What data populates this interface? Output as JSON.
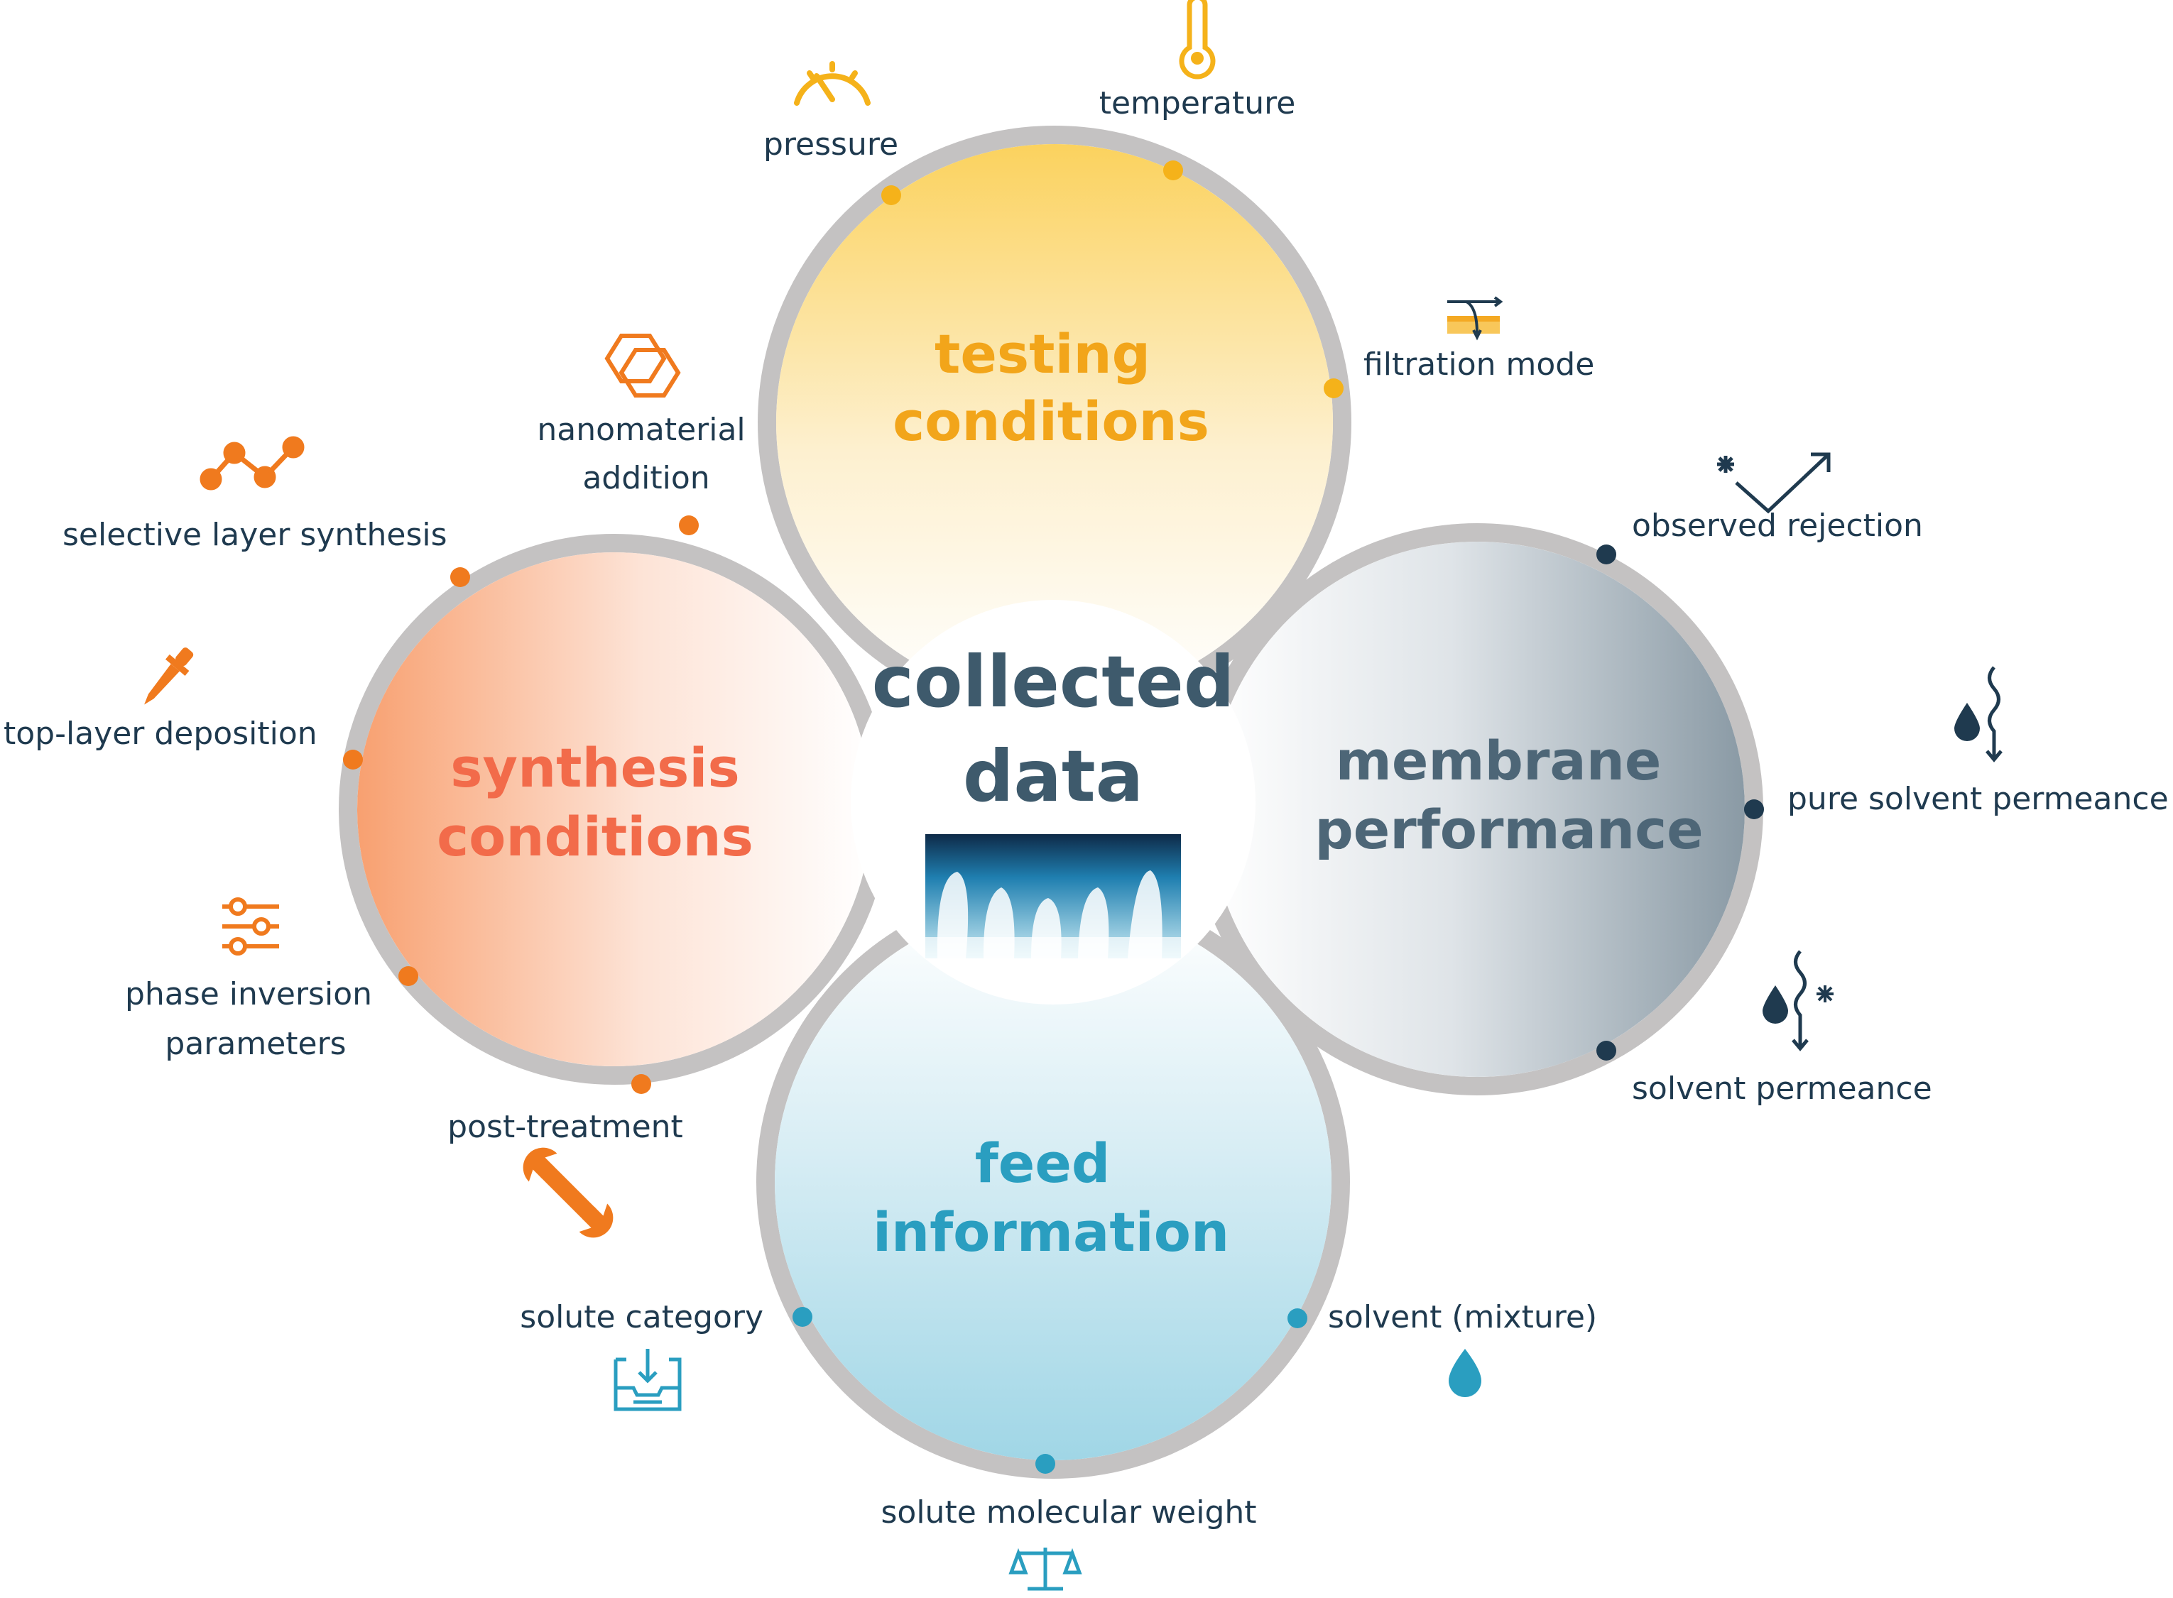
{
  "center": {
    "line1": "collected",
    "line2": "data"
  },
  "petals": {
    "testing": {
      "line1": "testing",
      "line2": "conditions"
    },
    "synthesis": {
      "line1": "synthesis",
      "line2": "conditions"
    },
    "membrane": {
      "line1": "membrane",
      "line2": "performance"
    },
    "feed": {
      "line1": "feed",
      "line2": "information"
    }
  },
  "labels": {
    "pressure": "pressure",
    "temperature": "temperature",
    "filtration_mode": "filtration mode",
    "nanomaterial_1": "nanomaterial",
    "nanomaterial_2": "addition",
    "selective_layer": "selective layer synthesis",
    "top_layer": "top-layer deposition",
    "phase_inversion_1": "phase inversion",
    "phase_inversion_2": "parameters",
    "post_treatment": "post-treatment",
    "observed_rejection": "observed rejection",
    "pure_solvent": "pure solvent permeance",
    "solvent_permeance": "solvent permeance",
    "solute_category": "solute category",
    "solvent_mixture": "solvent (mixture)",
    "solute_mw": "solute molecular weight"
  },
  "icons": [
    "gauge-icon",
    "thermometer-icon",
    "filtration-mode-icon",
    "hexagon-icon",
    "line-graph-icon",
    "dropper-icon",
    "sliders-icon",
    "wrench-icon",
    "rejection-icon",
    "droplet-wave-icon",
    "droplet-wave-star-icon",
    "inbox-icon",
    "droplet-icon",
    "balance-icon"
  ],
  "colors": {
    "testing": "#f7b500",
    "synthesis": "#f26b4a",
    "membrane": "#4d6677",
    "feed": "#2a9ec0",
    "orange_icon": "#f07a1e",
    "navy": "#1f3a4f",
    "ring": "#c4c2c2"
  }
}
